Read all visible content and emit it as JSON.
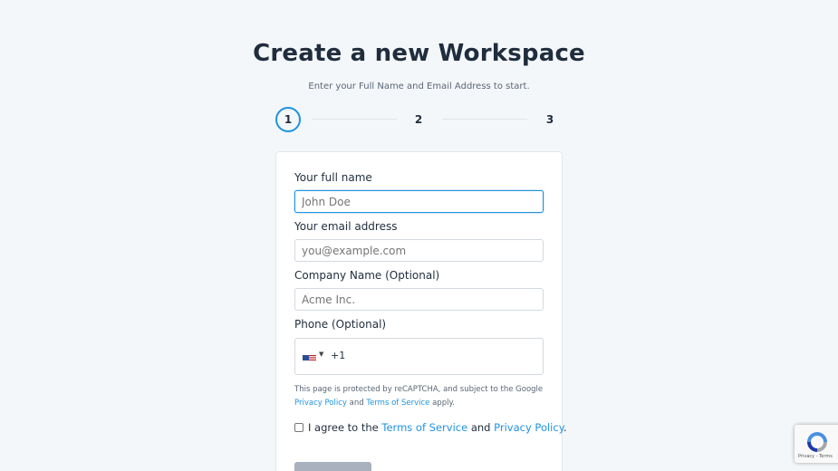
{
  "header": {
    "title": "Create a new Workspace",
    "subtitle": "Enter your Full Name and Email Address to start."
  },
  "steps": [
    {
      "label": "1",
      "active": true
    },
    {
      "label": "2",
      "active": false
    },
    {
      "label": "3",
      "active": false
    }
  ],
  "form": {
    "full_name": {
      "label": "Your full name",
      "placeholder": "John Doe"
    },
    "email": {
      "label": "Your email address",
      "placeholder": "you@example.com"
    },
    "company": {
      "label": "Company Name (Optional)",
      "placeholder": "Acme Inc."
    },
    "phone": {
      "label": "Phone (Optional)",
      "dial_code": "+1",
      "country": "us-flag-icon"
    }
  },
  "recaptcha_notice": {
    "prefix": "This page is protected by reCAPTCHA, and subject to the Google",
    "privacy_link": "Privacy Policy",
    "and": "and",
    "terms_link": "Terms of Service",
    "suffix": "apply."
  },
  "agree": {
    "prefix": "I agree to the",
    "terms_link": "Terms of Service",
    "and": "and",
    "privacy_link": "Privacy Policy",
    "suffix": "."
  },
  "recaptcha_badge": {
    "links": "Privacy - Terms"
  },
  "colors": {
    "accent": "#1f93e0",
    "background": "#f4f7fa",
    "button_disabled": "#a8b1bd"
  }
}
